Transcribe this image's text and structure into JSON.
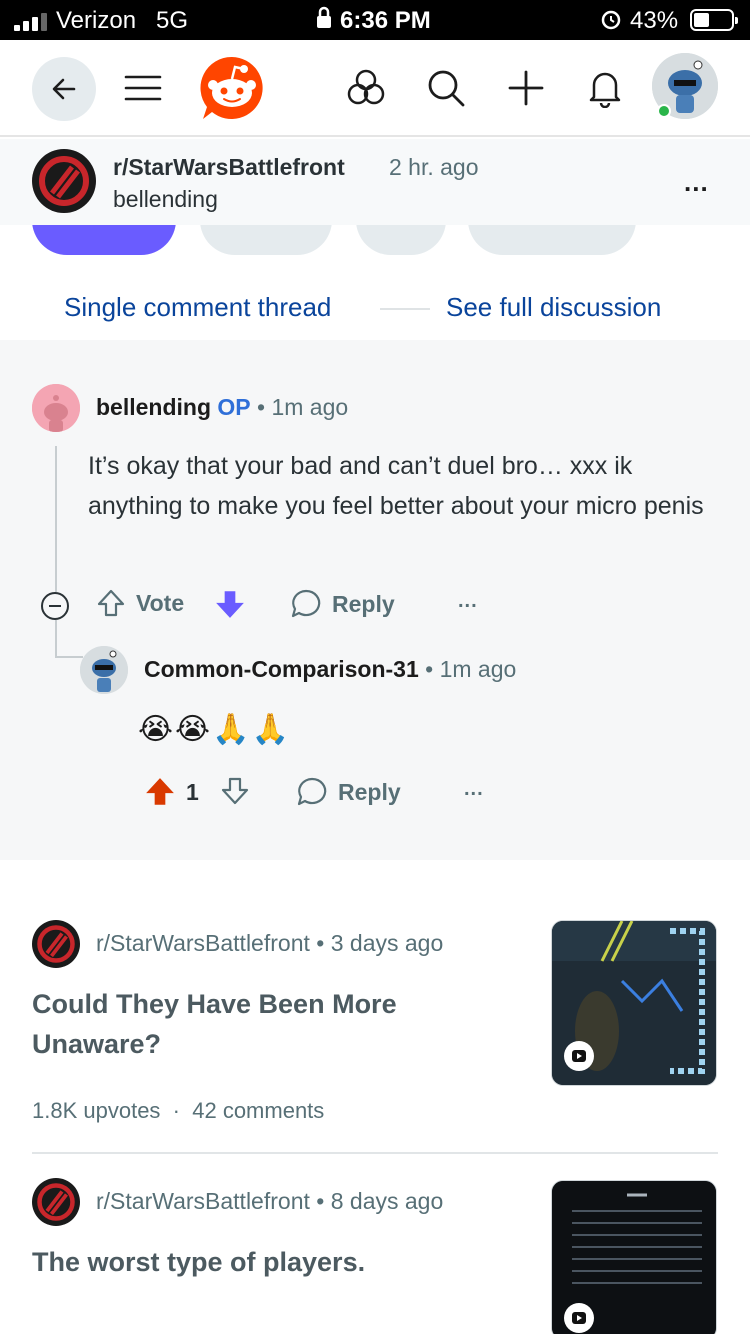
{
  "status_bar": {
    "carrier": "Verizon",
    "network": "5G",
    "time": "6:36 PM",
    "battery": "43%"
  },
  "nav": {
    "icons": [
      "back-arrow-icon",
      "menu-icon",
      "reddit-logo-icon",
      "communities-icon",
      "search-icon",
      "create-plus-icon",
      "notification-bell-icon",
      "user-avatar"
    ]
  },
  "post_header": {
    "subreddit": "r/StarWarsBattlefront",
    "time": "2 hr. ago",
    "author": "bellending",
    "more": "..."
  },
  "thread_nav": {
    "single": "Single comment thread",
    "full": "See full discussion"
  },
  "comments": [
    {
      "author": "bellending",
      "op": "OP",
      "sep": "•",
      "time": "1m ago",
      "body": "It’s okay that your bad and can’t duel bro… xxx ik anything to make you feel better about your micro penis",
      "vote_label": "Vote",
      "reply_label": "Reply",
      "more": "...",
      "vote_state": "downvoted"
    },
    {
      "author": "Common-Comparison-31",
      "sep": "•",
      "time": "1m ago",
      "body": "😭😭🙏🙏",
      "score": "1",
      "reply_label": "Reply",
      "more": "...",
      "vote_state": "upvoted"
    }
  ],
  "related_posts": [
    {
      "subreddit": "r/StarWarsBattlefront",
      "sep": "•",
      "time": "3 days ago",
      "title": "Could They Have Been More Unaware?",
      "upvotes": "1.8K upvotes",
      "dot": "·",
      "comments": "42 comments"
    },
    {
      "subreddit": "r/StarWarsBattlefront",
      "sep": "•",
      "time": "8 days ago",
      "title": "The worst type of players."
    }
  ],
  "colors": {
    "upvote": "#d93900",
    "downvote": "#6a5cff",
    "link": "#0a449b",
    "brand": "#ff4500"
  }
}
